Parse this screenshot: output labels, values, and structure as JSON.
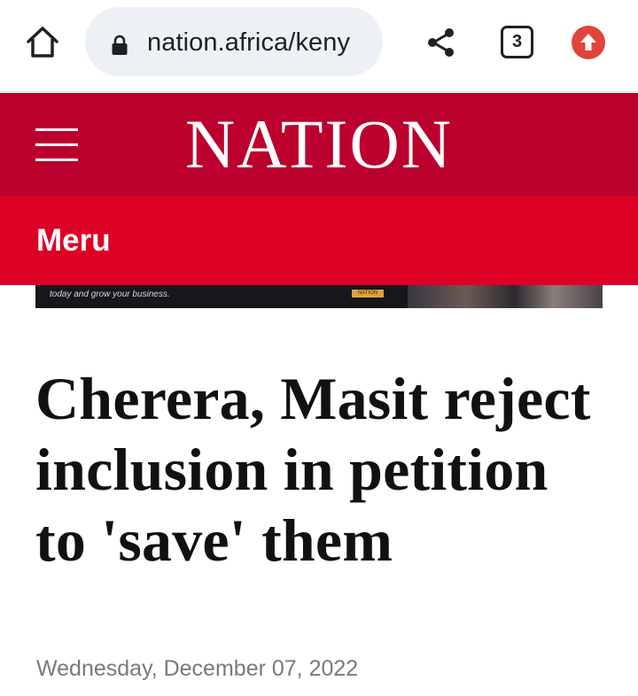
{
  "browser": {
    "url": "nation.africa/keny",
    "tab_count": "3",
    "icons": {
      "home": "home-icon",
      "lock": "lock-icon",
      "share": "share-icon",
      "tabs": "tab-switcher-icon",
      "upload": "upload-icon"
    }
  },
  "site": {
    "brand": "NATION",
    "menu_icon": "hamburger-menu-icon",
    "section": "Meru",
    "colors": {
      "header": "#bc002d",
      "section_bar": "#de0024",
      "upload_badge": "#e0443d"
    }
  },
  "ad": {
    "text": "today and grow your business.",
    "logo_text": "NATION"
  },
  "article": {
    "headline": "Cherera, Masit reject inclusion in petition to 'save' them",
    "date": "Wednesday, December 07, 2022"
  }
}
